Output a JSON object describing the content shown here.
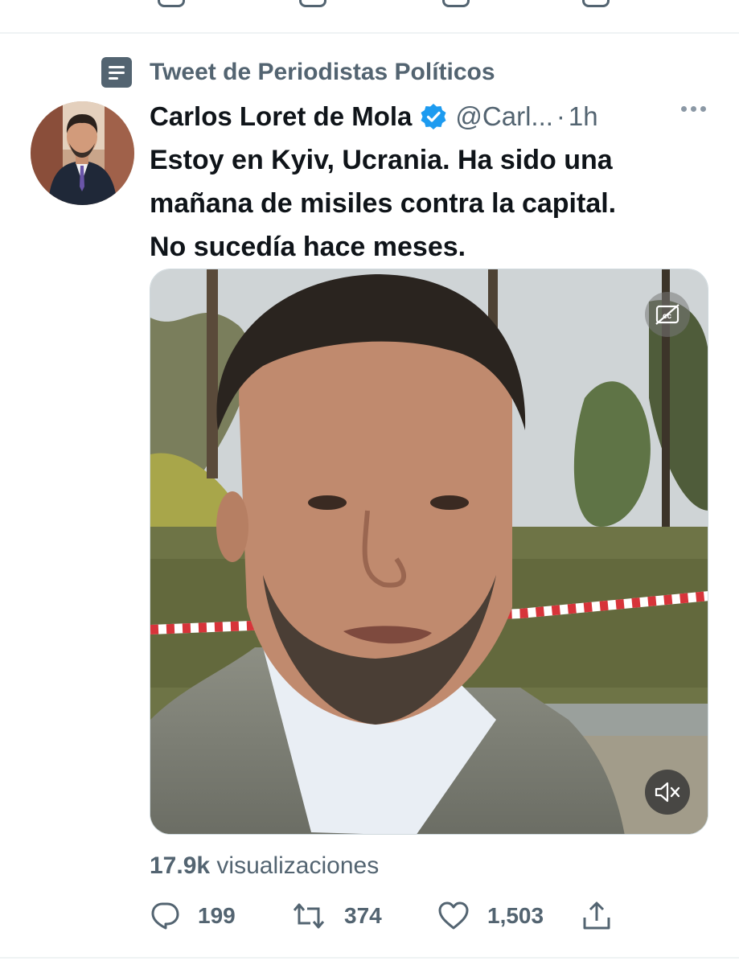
{
  "context": {
    "label": "Tweet de Periodistas Políticos",
    "icon": "list-icon"
  },
  "tweet": {
    "author": {
      "display_name": "Carlos Loret de Mola",
      "verified": true,
      "handle": "@Carl...",
      "separator": "·",
      "time": "1h"
    },
    "text_lines": [
      "Estoy en Kyiv, Ucrania. Ha sido una",
      "mañana de misiles contra la capital.",
      "No sucedía hace meses."
    ],
    "media": {
      "type": "video",
      "captions_icon": "captions-off-icon",
      "mute_icon": "muted-speaker-icon"
    },
    "views": {
      "count": "17.9k",
      "label": "visualizaciones"
    },
    "actions": {
      "replies": "199",
      "retweets": "374",
      "likes": "1,503"
    }
  },
  "colors": {
    "text_primary": "#0f1419",
    "text_secondary": "#536471",
    "verified_blue": "#1d9bf0",
    "divider": "#eff3f4"
  }
}
